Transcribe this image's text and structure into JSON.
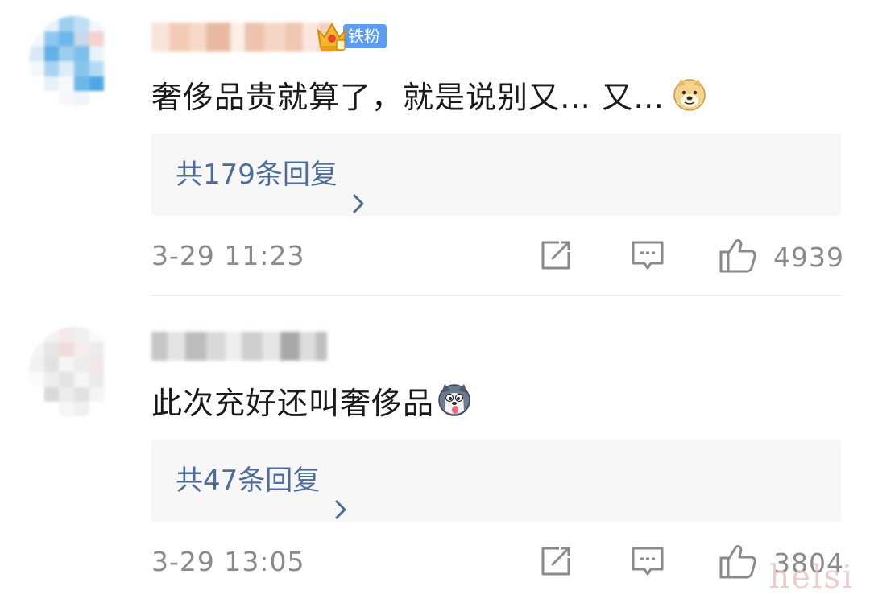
{
  "comments": [
    {
      "badge_label": "铁粉",
      "text": "奢侈品贵就算了，就是说别又… 又…",
      "reply_link": "共179条回复",
      "timestamp": "3-29 11:23",
      "like_count": "4939"
    },
    {
      "text": "此次充好还叫奢侈品",
      "reply_link": "共47条回复",
      "timestamp": "3-29 13:05",
      "like_count": "3804"
    }
  ],
  "icons": {
    "emoji_1": "doge-emoji-icon",
    "emoji_2": "husky-emoji-icon",
    "share": "share-edit-icon",
    "comment": "comment-bubble-icon",
    "like": "thumbs-up-icon",
    "chevron": "chevron-right-icon",
    "crown": "crown-badge-icon"
  },
  "colors": {
    "link": "#4e6c99",
    "meta": "#8a8a8a",
    "badge": "#5b9df5",
    "reply_bg": "#f7f7f7"
  },
  "watermark": "helsi"
}
